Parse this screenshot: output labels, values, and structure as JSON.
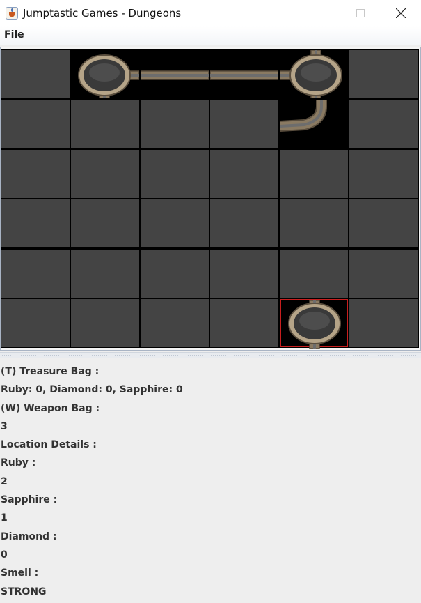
{
  "window": {
    "title": "Jumptastic Games - Dungeons",
    "icon": "java-cup-icon"
  },
  "menu": {
    "items": [
      "File"
    ]
  },
  "board": {
    "rows": 6,
    "cols": 6,
    "tile_color": "#444444",
    "highlight_color": "#c81e1e",
    "visited_cells": [
      {
        "row": 0,
        "col": 1,
        "tile": "room-right-down"
      },
      {
        "row": 0,
        "col": 2,
        "tile": "corridor-horizontal"
      },
      {
        "row": 0,
        "col": 3,
        "tile": "corridor-horizontal"
      },
      {
        "row": 0,
        "col": 4,
        "tile": "room-left-up-down"
      },
      {
        "row": 1,
        "col": 4,
        "tile": "corridor-bend-up-left"
      },
      {
        "row": 5,
        "col": 4,
        "tile": "room-up-down",
        "current": true
      }
    ]
  },
  "info": {
    "treasure_label": "(T) Treasure Bag :",
    "treasure_value": "Ruby: 0, Diamond: 0, Sapphire: 0",
    "weapon_label": "(W) Weapon Bag :",
    "weapon_value": "3",
    "location_label": "Location Details :",
    "ruby_label": "Ruby :",
    "ruby_value": "2",
    "sapphire_label": "Sapphire :",
    "sapphire_value": "1",
    "diamond_label": "Diamond :",
    "diamond_value": "0",
    "smell_label": "Smell :",
    "smell_value": "STRONG"
  }
}
